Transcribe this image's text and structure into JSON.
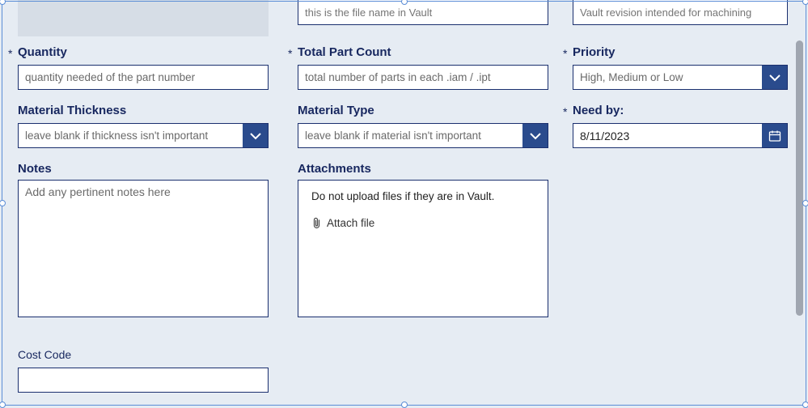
{
  "top_row": {
    "file_name_placeholder": "this is the file name in Vault",
    "revision_placeholder": "Vault revision intended for machining"
  },
  "quantity": {
    "label": "Quantity",
    "required": "*",
    "placeholder": "quantity needed of the part number"
  },
  "total_part_count": {
    "label": "Total Part Count",
    "required": "*",
    "placeholder": "total number of parts in each .iam / .ipt"
  },
  "priority": {
    "label": "Priority",
    "required": "*",
    "placeholder": "High, Medium or Low"
  },
  "material_thickness": {
    "label": "Material Thickness",
    "placeholder": "leave blank if thickness isn't important"
  },
  "material_type": {
    "label": "Material Type",
    "placeholder": "leave blank if material isn't important"
  },
  "need_by": {
    "label": "Need by:",
    "required": "*",
    "value": "8/11/2023"
  },
  "notes": {
    "label": "Notes",
    "placeholder": "Add any pertinent notes here"
  },
  "attachments": {
    "label": "Attachments",
    "note": "Do not upload files if they are in Vault.",
    "link": "Attach file"
  },
  "cost_code": {
    "label": "Cost Code"
  }
}
